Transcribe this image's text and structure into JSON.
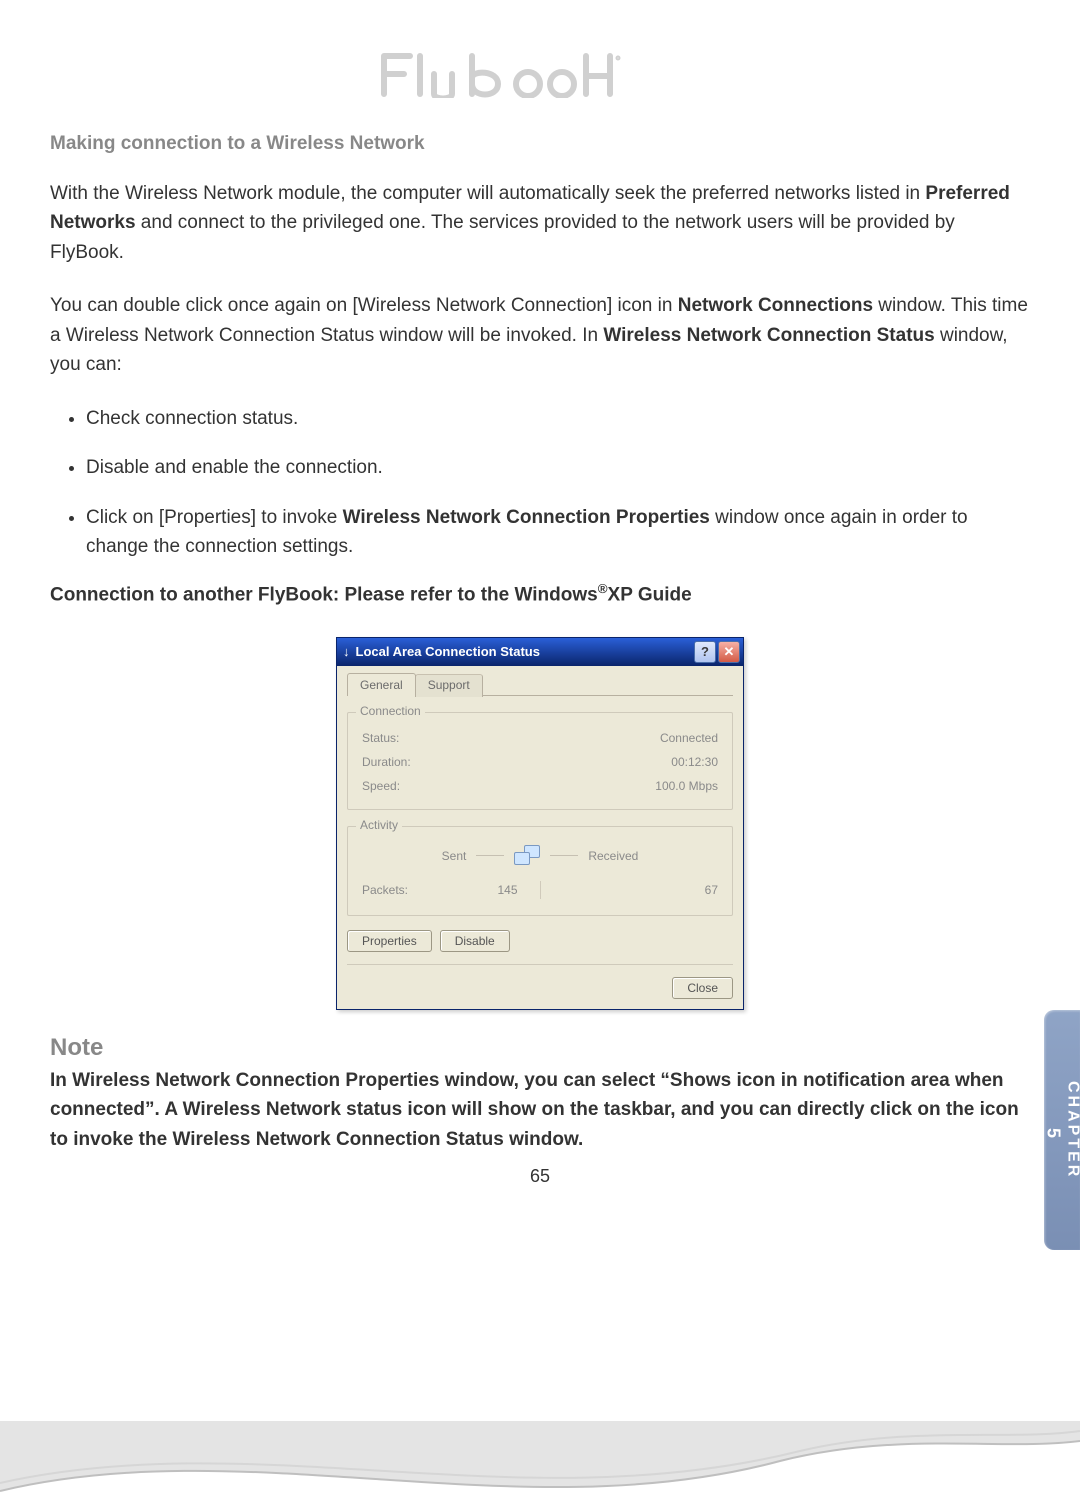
{
  "logo_alt": "Flybook",
  "heading": "Making connection to a Wireless Network",
  "para1_prefix": "With the Wireless Network module, the computer will automatically seek the preferred networks listed in ",
  "para1_bold": "Preferred Networks",
  "para1_suffix": " and connect to the privileged one. The services provided to the network users will be provided by FlyBook.",
  "para2_a": "You can double click once again on [Wireless Network Connection] icon in ",
  "para2_b": "Network Connections",
  "para2_c": " window. This time a Wireless Network Connection Status window will be invoked. In ",
  "para2_d": "Wireless Network Connection Status",
  "para2_e": " window, you can:",
  "bullets": {
    "b1": "Check connection status.",
    "b2": "Disable and enable the connection.",
    "b3_a": "Click on [Properties] to invoke ",
    "b3_b": "Wireless Network Connection Properties",
    "b3_c": " window once again in order to change the connection settings."
  },
  "sub_a": "Connection to another FlyBook: Please refer to the Windows",
  "sub_reg": "®",
  "sub_b": "XP Guide",
  "dialog": {
    "title": "Local Area Connection Status",
    "tab_general": "General",
    "tab_support": "Support",
    "group_connection": "Connection",
    "status_label": "Status:",
    "status_value": "Connected",
    "duration_label": "Duration:",
    "duration_value": "00:12:30",
    "speed_label": "Speed:",
    "speed_value": "100.0 Mbps",
    "group_activity": "Activity",
    "sent_label": "Sent",
    "received_label": "Received",
    "packets_label": "Packets:",
    "packets_sent": "145",
    "packets_received": "67",
    "btn_properties": "Properties",
    "btn_disable": "Disable",
    "btn_close": "Close"
  },
  "note_title": "Note",
  "note_body": "In Wireless Network Connection Properties window, you can select “Shows icon in notification area when connected”. A Wireless Network status icon will show on the taskbar, and you can directly click on the icon to invoke the Wireless Network Connection Status window.",
  "page_number": "65",
  "chapter_label": "CHAPTER",
  "chapter_number": "5"
}
